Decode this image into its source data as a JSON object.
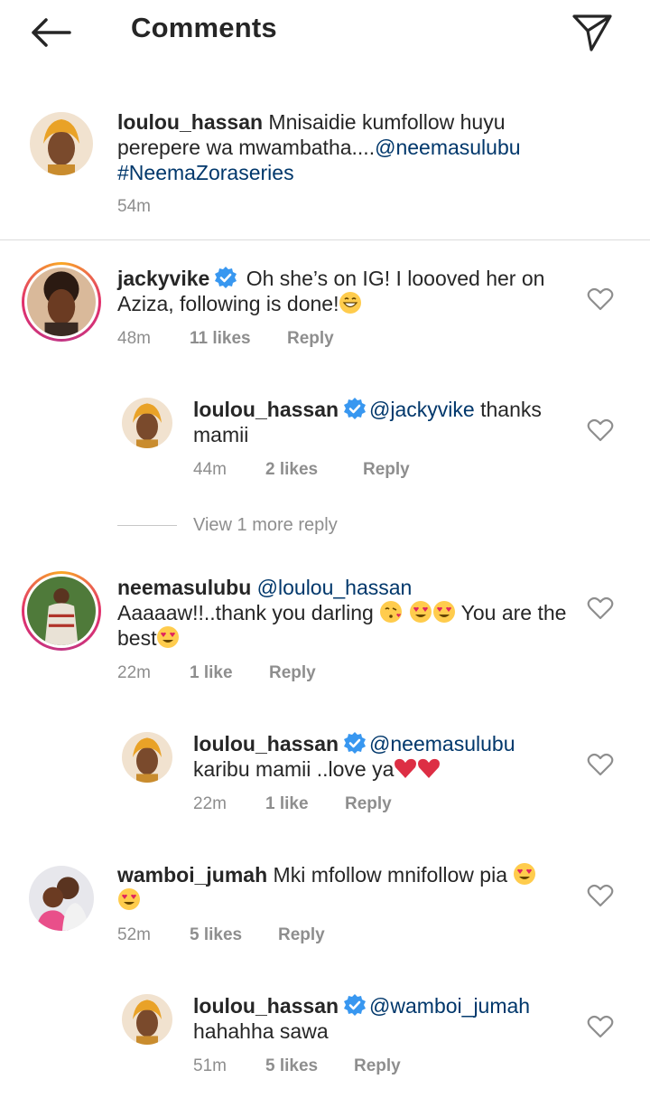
{
  "header": {
    "title": "Comments",
    "back_icon": "arrow-left-icon",
    "send_icon": "paper-plane-icon"
  },
  "caption": {
    "username": "loulou_hassan",
    "text_part1": " Mnisaidie kumfollow huyu perepere wa mwambatha....",
    "mention": "@neemasulubu",
    "hashtag": "#NeemaZoraseries",
    "time": "54m"
  },
  "comments": [
    {
      "username": "jackyvike",
      "verified": true,
      "text": " Oh she’s on IG! I loooved her on Aziza, following is done!",
      "time": "48m",
      "likes": "11 likes",
      "reply_label": "Reply",
      "replies": [
        {
          "username": "loulou_hassan",
          "verified": true,
          "mention": "@jackyvike",
          "text": " thanks mamii",
          "time": "44m",
          "likes": "2 likes",
          "reply_label": "Reply"
        }
      ],
      "view_more": "View 1 more reply"
    },
    {
      "username": "neemasulubu",
      "verified": false,
      "mention": "@loulou_hassan",
      "text_part1": "Aaaaaw!!..thank you darling ",
      "text_part2": " You are the best",
      "time": "22m",
      "likes": "1 like",
      "reply_label": "Reply",
      "replies": [
        {
          "username": "loulou_hassan",
          "verified": true,
          "mention": "@neemasulubu",
          "text": "karibu mamii ..love ya",
          "time": "22m",
          "likes": "1 like",
          "reply_label": "Reply"
        }
      ]
    },
    {
      "username": "wamboi_jumah",
      "verified": false,
      "text": " Mki mfollow mnifollow pia ",
      "time": "52m",
      "likes": "5 likes",
      "reply_label": "Reply",
      "replies": [
        {
          "username": "loulou_hassan",
          "verified": true,
          "mention": "@wamboi_jumah",
          "text": "hahahha sawa",
          "time": "51m",
          "likes": "5 likes",
          "reply_label": "Reply"
        }
      ]
    }
  ],
  "colors": {
    "text": "#262626",
    "secondary": "#8e8e8e",
    "mention": "#00376b",
    "verified": "#3897f0",
    "divider": "#dbdbdb"
  }
}
